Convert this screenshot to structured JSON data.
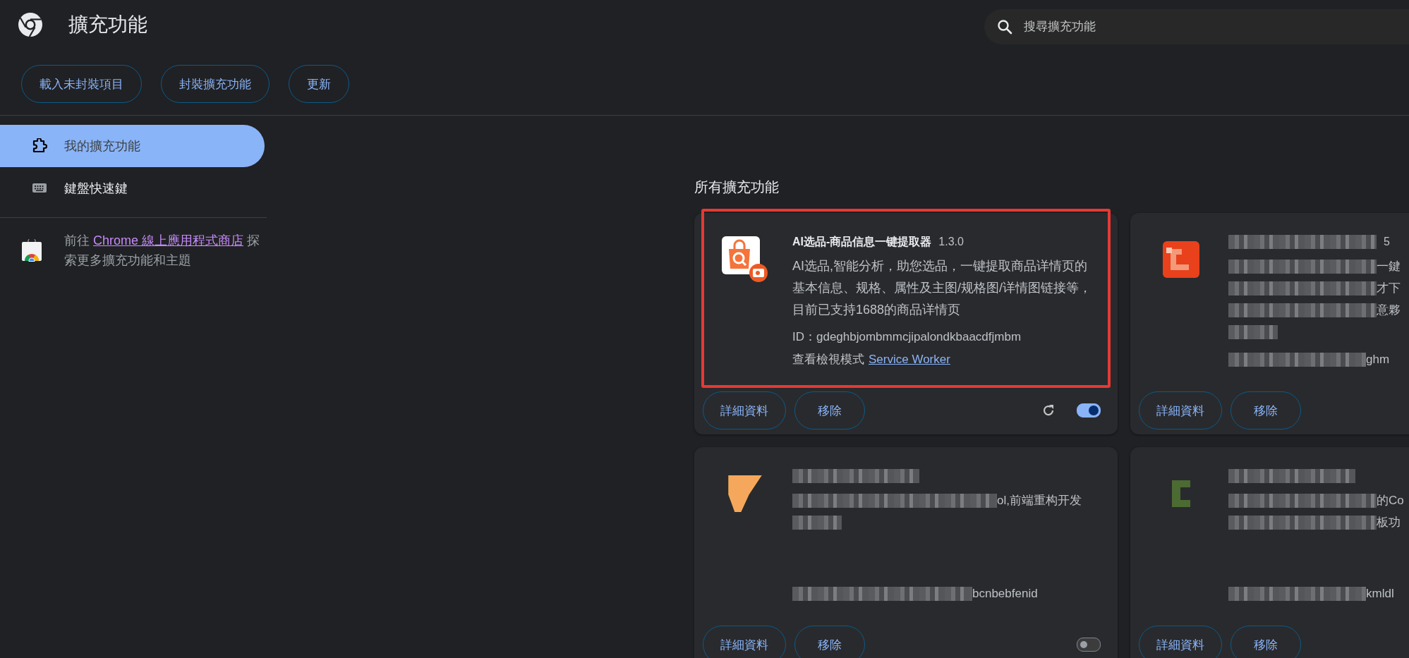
{
  "header": {
    "title": "擴充功能",
    "search": {
      "placeholder": "搜尋擴充功能"
    }
  },
  "toolbar_buttons": [
    "載入未封裝項目",
    "封裝擴充功能",
    "更新"
  ],
  "sidebar": {
    "items": [
      {
        "label": "我的擴充功能",
        "selected": true
      },
      {
        "label": "鍵盤快速鍵",
        "selected": false
      }
    ],
    "store_link": {
      "before": "前往",
      "link": "Chrome 線上應用程式商店",
      "after": "探索更多擴充功能和主題"
    }
  },
  "section_title": "所有擴充功能",
  "extensions": [
    {
      "kind": "full",
      "name": "AI选品-商品信息一键提取器",
      "version": "1.3.0",
      "description": "AI选品,智能分析，助您选品，一键提取商品详情页的基本信息、规格、属性及主图/规格图/详情图链接等，目前已支持1688的商品详情页",
      "id": "ID：gdeghbjombmmcjipalondkbaacdfjmbm",
      "inspect_label": "查看檢視模式",
      "inspect_link": "Service Worker",
      "buttons": [
        "詳細資料",
        "移除"
      ],
      "reloadable": true,
      "enabled": true,
      "highlighted": true
    },
    {
      "kind": "obscured",
      "title_fragment": "5",
      "description_lines": [
        {
          "kind": "partial",
          "text": "一鍵"
        },
        {
          "kind": "partial",
          "text": "才下"
        },
        {
          "kind": "partial",
          "text": "意夥"
        },
        {
          "kind": "hidden"
        }
      ],
      "id_fragment": "ghm",
      "buttons": [
        "詳細資料",
        "移除"
      ],
      "highlighted": false
    },
    {
      "kind": "obscured",
      "description_lines": [
        {
          "kind": "partial",
          "text": "ol,前端重构开发"
        },
        {
          "kind": "hidden"
        }
      ],
      "id_fragment": "bcnbebfenid",
      "buttons": [
        "詳細資料",
        "移除"
      ],
      "reloadable": false,
      "enabled": false,
      "highlighted": false
    },
    {
      "kind": "obscured",
      "description_lines": [
        {
          "kind": "partial",
          "text": "的Co"
        },
        {
          "kind": "partial",
          "text": "板功"
        }
      ],
      "id_fragment": "kmldl",
      "buttons": [
        "詳細資料",
        "移除"
      ],
      "highlighted": false
    }
  ]
}
